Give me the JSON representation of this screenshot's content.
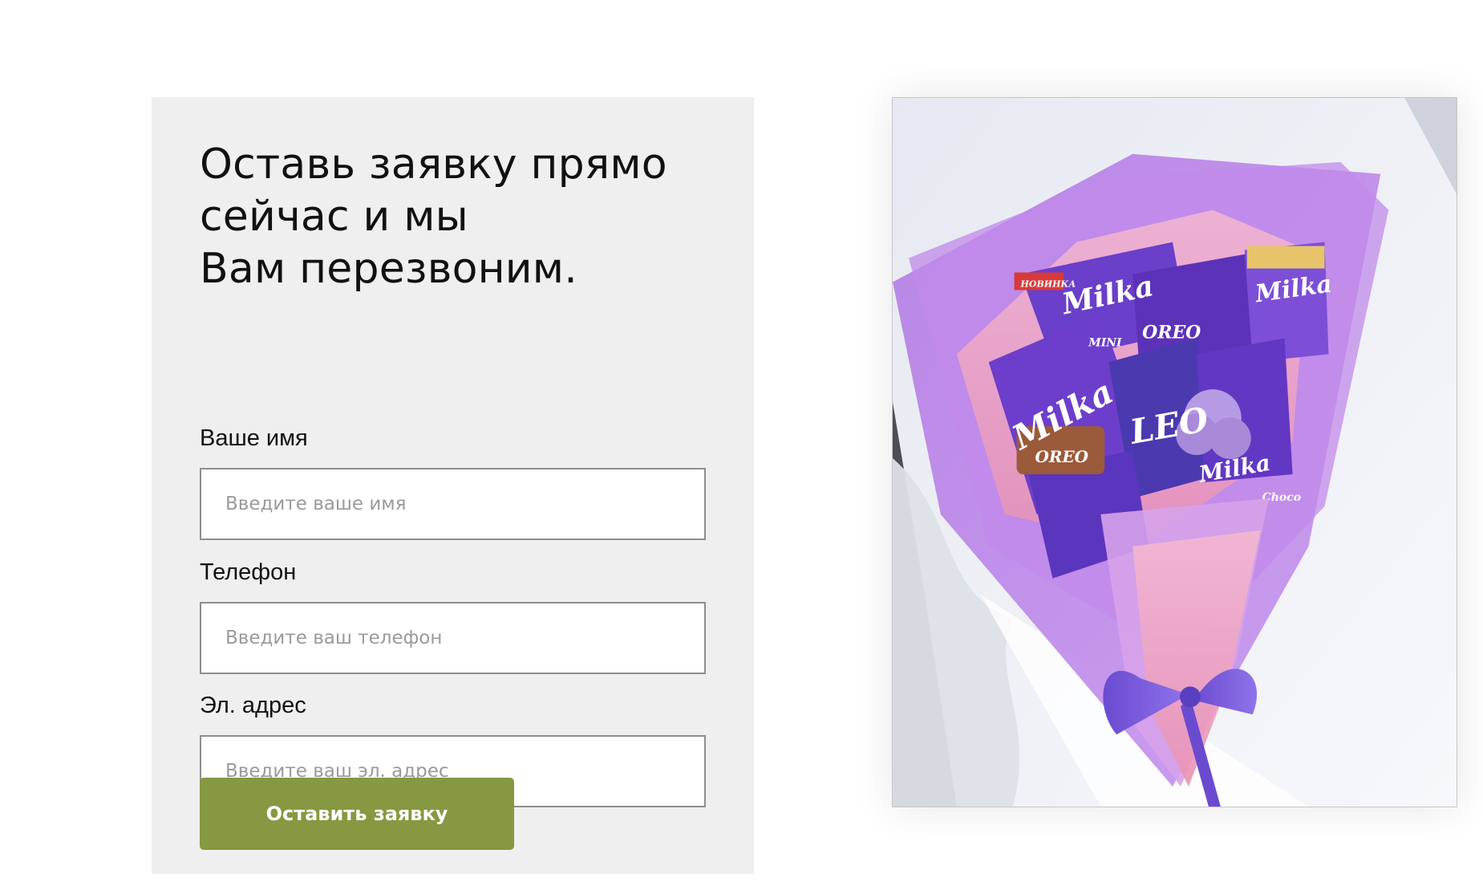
{
  "form": {
    "title": "Оставь заявку прямо\nсейчас и мы\nВам перезвоним.",
    "fields": [
      {
        "label": "Ваше имя",
        "placeholder": "Введите ваше имя",
        "value": ""
      },
      {
        "label": "Телефон",
        "placeholder": "Введите ваш телефон",
        "value": ""
      },
      {
        "label": "Эл. адрес",
        "placeholder": "Введите ваш эл. адрес",
        "value": ""
      }
    ],
    "submit_label": "Оставить заявку"
  },
  "photo": {
    "brand_marks": [
      "Milka",
      "OREO",
      "LEO",
      "НОВИНКА",
      "Choco",
      "MINI"
    ]
  },
  "colors": {
    "form_background": "#efefef",
    "button": "#879842",
    "button_text": "#ffffff",
    "input_border": "#8e8e8e",
    "wrap_purple": "#b67ee6",
    "wrap_pink": "#f2a9c4",
    "milka_purple": "#6f40c9"
  }
}
